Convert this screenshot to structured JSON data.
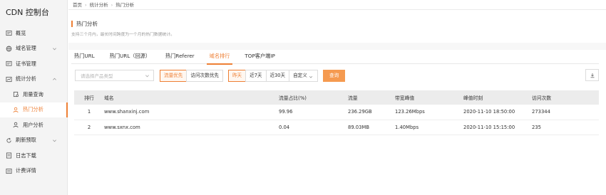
{
  "sidebar": {
    "title": "CDN 控制台",
    "items": [
      {
        "label": "概览"
      },
      {
        "label": "域名管理"
      },
      {
        "label": "证书管理"
      },
      {
        "label": "统计分析"
      },
      {
        "label": "用量查询"
      },
      {
        "label": "热门分析"
      },
      {
        "label": "用户分析"
      },
      {
        "label": "刷新预取"
      },
      {
        "label": "日志下载"
      },
      {
        "label": "计费详情"
      }
    ]
  },
  "breadcrumb": [
    "首页",
    "统计分析",
    "热门分析"
  ],
  "page": {
    "title": "热门分析",
    "description": "支持三个月内，最长时间跨度为一个月的热门数据统计。"
  },
  "tabs": [
    "热门URL",
    "热门URL（回源）",
    "热门Referer",
    "域名排行",
    "TOP客户端IP"
  ],
  "toolbar": {
    "select_placeholder": "请选择产品类型",
    "sort_options": [
      "流量优先",
      "访问次数优先"
    ],
    "time_options": [
      "昨天",
      "近7天",
      "近30天",
      "自定义"
    ],
    "query_label": "查询"
  },
  "table": {
    "headers": [
      "排行",
      "域名",
      "流量占比(%)",
      "流量",
      "带宽峰值",
      "峰值时刻",
      "访问次数"
    ],
    "rows": [
      [
        "1",
        "www.shanxinj.com",
        "99.96",
        "236.29GB",
        "123.26Mbps",
        "2020-11-10 18:50:00",
        "273344"
      ],
      [
        "2",
        "www.sxnx.com",
        "0.04",
        "89.03MB",
        "1.40Mbps",
        "2020-11-10 15:15:00",
        "235"
      ]
    ]
  },
  "colors": {
    "accent": "#ee7f34"
  }
}
